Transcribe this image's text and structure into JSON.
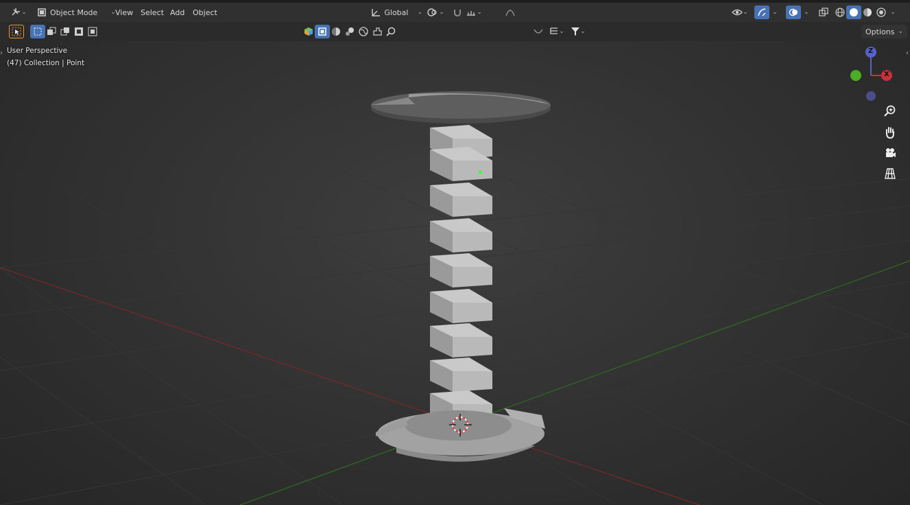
{
  "header": {
    "mode": "Object Mode",
    "menus": [
      "View",
      "Select",
      "Add",
      "Object"
    ],
    "transform_orientation": "Global"
  },
  "toolbar": {
    "options_label": "Options"
  },
  "viewport": {
    "view_name": "User Perspective",
    "collection_info": "(47) Collection | Point"
  },
  "gizmo": {
    "z_label": "Z",
    "x_label": "X",
    "x_color": "#c8303a",
    "y_color": "#4cae24",
    "z_color": "#5761c9"
  },
  "colors": {
    "accent": "#4772b3",
    "x_axis": "#8a2b2b",
    "y_axis": "#3a7a22",
    "grid": "#3a3a3a"
  }
}
